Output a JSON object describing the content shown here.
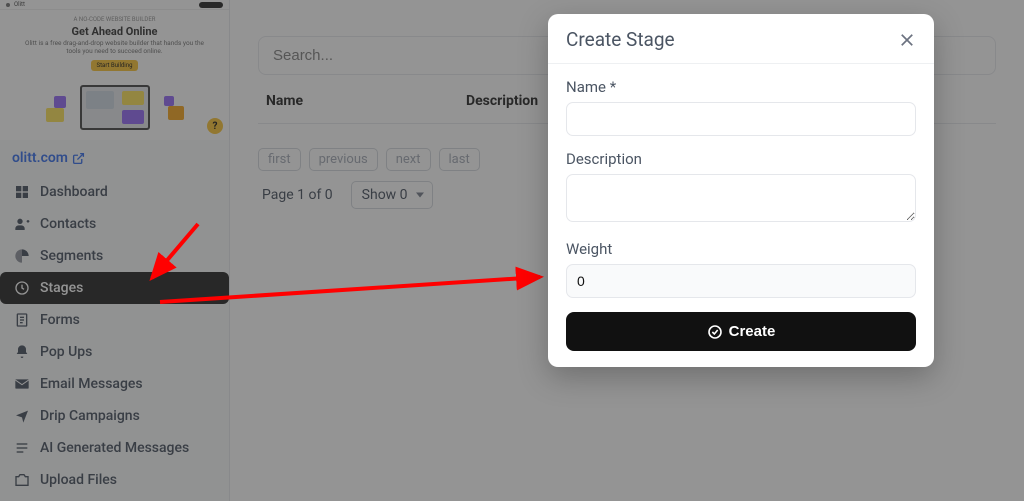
{
  "preview": {
    "tiny": "A NO-CODE WEBSITE BUILDER",
    "title": "Get Ahead Online",
    "sub": "Olitt is a free drag-and-drop website builder that hands you the tools you need to succeed online.",
    "cta": "Start Building"
  },
  "site_link": "olitt.com",
  "nav": [
    {
      "label": "Dashboard",
      "icon": "dashboard"
    },
    {
      "label": "Contacts",
      "icon": "contacts"
    },
    {
      "label": "Segments",
      "icon": "segments"
    },
    {
      "label": "Stages",
      "icon": "stages"
    },
    {
      "label": "Forms",
      "icon": "forms"
    },
    {
      "label": "Pop Ups",
      "icon": "popups"
    },
    {
      "label": "Email Messages",
      "icon": "email"
    },
    {
      "label": "Drip Campaigns",
      "icon": "drip"
    },
    {
      "label": "AI Generated Messages",
      "icon": "ai"
    },
    {
      "label": "Upload Files",
      "icon": "upload"
    }
  ],
  "main": {
    "search_placeholder": "Search...",
    "columns": {
      "name": "Name",
      "description": "Description"
    },
    "pager": {
      "first": "first",
      "previous": "previous",
      "next": "next",
      "last": "last",
      "info": "Page 1 of 0",
      "show": "Show 0"
    }
  },
  "modal": {
    "title": "Create Stage",
    "fields": {
      "name_label": "Name *",
      "name_value": "",
      "desc_label": "Description",
      "desc_value": "",
      "weight_label": "Weight",
      "weight_value": "0"
    },
    "submit": "Create"
  }
}
